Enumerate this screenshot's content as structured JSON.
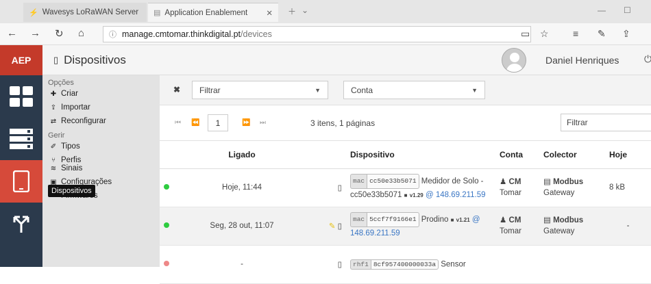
{
  "browser": {
    "tab1_title": "Wavesys LoRaWAN Server",
    "tab2_title": "Application Enablement",
    "url_host": "manage.cmtomar.thinkdigital.pt",
    "url_path": "/devices"
  },
  "app": {
    "logo": "AEP",
    "page_title": "Dispositivos",
    "user_name": "Daniel Henriques",
    "tooltip": "Dispositivos"
  },
  "menu": {
    "section1": "Opções",
    "criar": "Criar",
    "importar": "Importar",
    "reconfigurar": "Reconfigurar",
    "section2": "Gerir",
    "tipos": "Tipos",
    "perfis": "Perfis",
    "sinais": "Sinais",
    "configuracoes": "Configurações",
    "firmwares": "Firmwares"
  },
  "filters": {
    "filtrar_select": "Filtrar",
    "conta_select": "Conta",
    "page": "1",
    "page_info": "3 itens, 1 páginas",
    "search": "Filtrar"
  },
  "columns": {
    "ligado": "Ligado",
    "dispositivo": "Dispositivo",
    "conta": "Conta",
    "colector": "Colector",
    "hoje": "Hoje"
  },
  "rows": [
    {
      "status_color": "#2ecc40",
      "ligado": "Hoje, 11:44",
      "tag_type": "mac",
      "tag_value": "cc50e33b5071",
      "name": "Medidor de Solo -",
      "name2": "cc50e33b5071",
      "version": "v1.29",
      "ip": "@ 148.69.211.59",
      "conta1": "CM",
      "conta2": "Tomar",
      "colector1": "Modbus",
      "colector2": "Gateway",
      "hoje": "8 kB"
    },
    {
      "status_color": "#2ecc40",
      "ligado": "Seg, 28 out, 11:07",
      "tag_type": "mac",
      "tag_value": "5ccf7f9166e1",
      "name": "Prodino",
      "version": "v1.21",
      "ip": "@",
      "ip2": "148.69.211.59",
      "conta1": "CM",
      "conta2": "Tomar",
      "colector1": "Modbus",
      "colector2": "Gateway",
      "hoje": "-"
    },
    {
      "status_color": "#e88",
      "ligado": "-",
      "tag_type": "rhf1",
      "tag_value": "8cf957400000033a",
      "name": "Sensor"
    }
  ]
}
